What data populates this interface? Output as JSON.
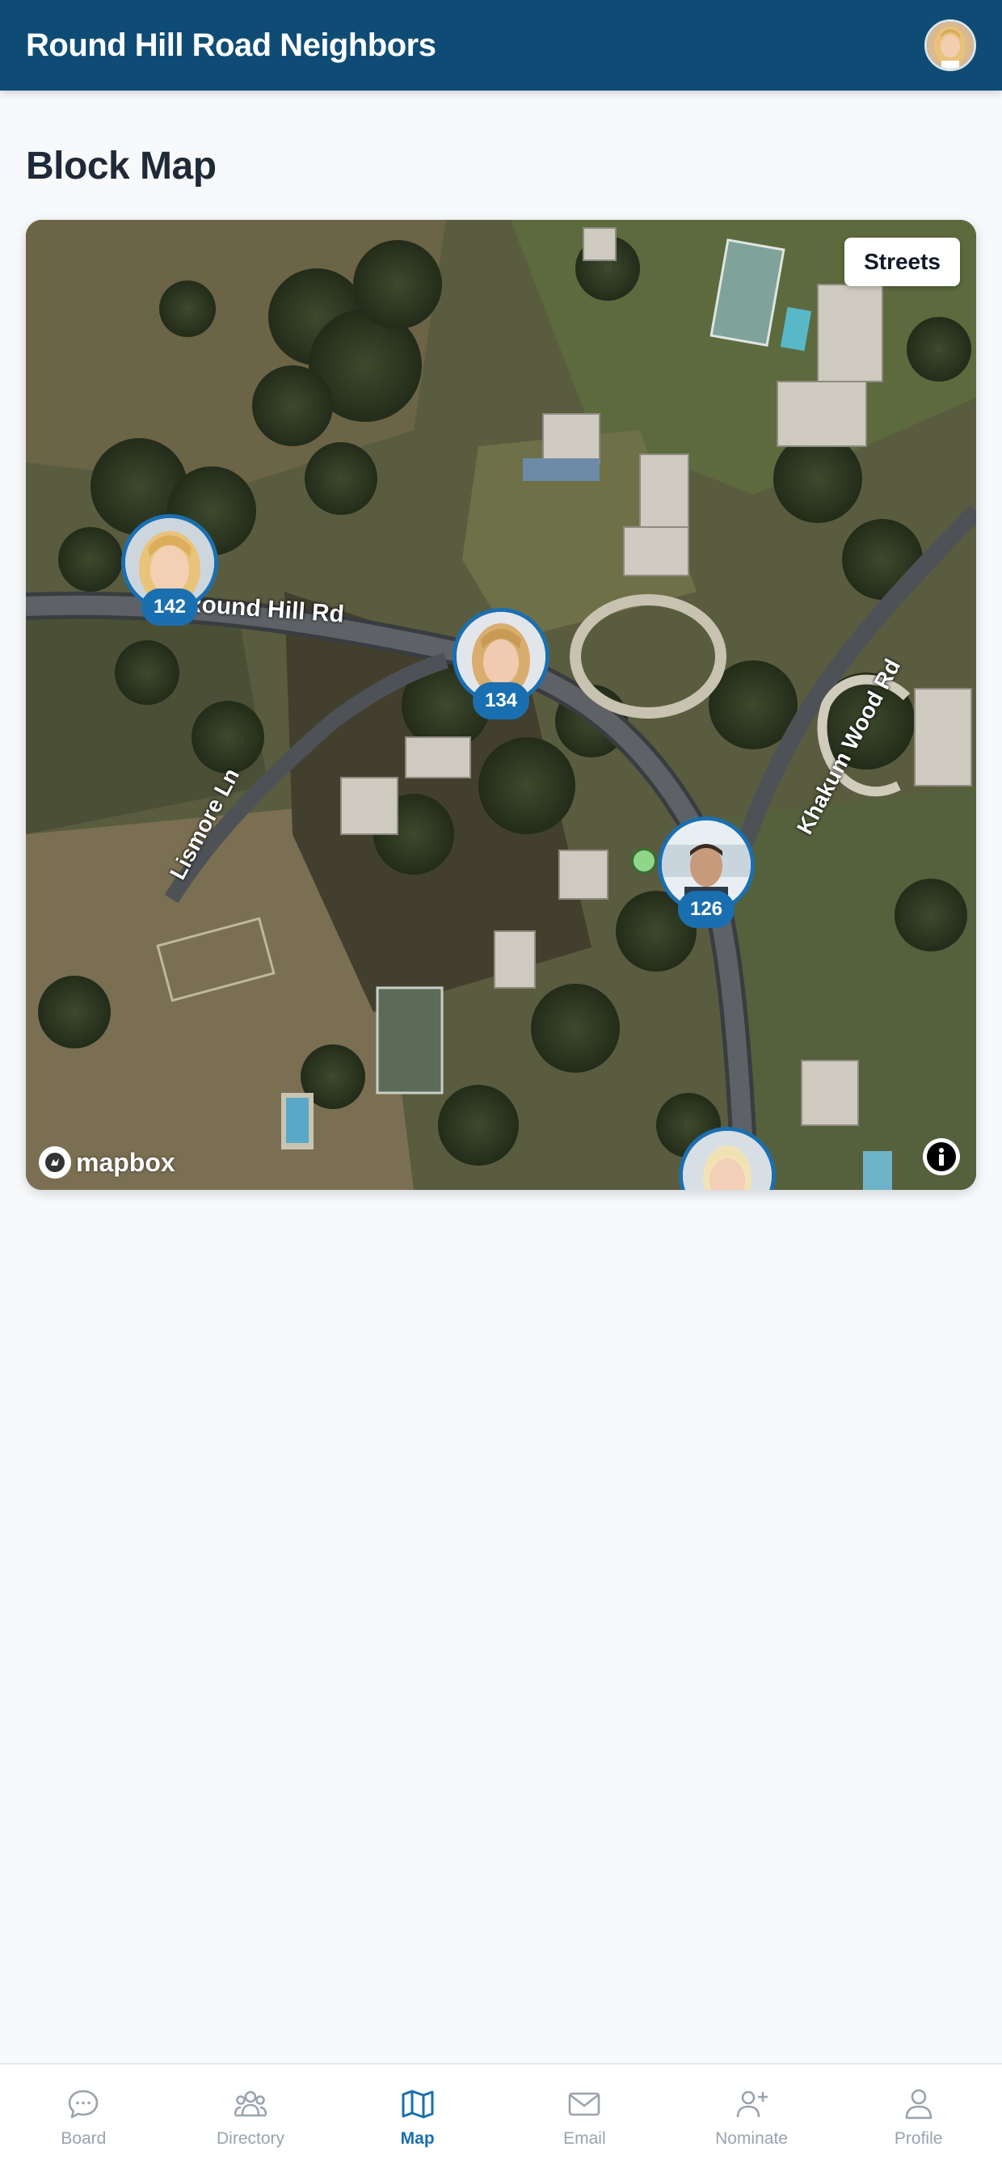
{
  "header": {
    "title": "Round Hill Road Neighbors",
    "avatar_icon": "user-avatar"
  },
  "page": {
    "title": "Block Map"
  },
  "map": {
    "style_toggle_label": "Streets",
    "roads": {
      "round_hill": "Round Hill Rd",
      "lismore": "Lismore Ln",
      "khakum": "Khakum Wood Rd"
    },
    "markers": [
      {
        "house_number": "142"
      },
      {
        "house_number": "134"
      },
      {
        "house_number": "126"
      },
      {
        "house_number": ""
      }
    ],
    "attribution": "mapbox",
    "accent_color": "#1a6fb0"
  },
  "nav": {
    "items": [
      {
        "label": "Board",
        "icon": "chat-bubble-icon"
      },
      {
        "label": "Directory",
        "icon": "people-icon"
      },
      {
        "label": "Map",
        "icon": "map-icon",
        "active": true
      },
      {
        "label": "Email",
        "icon": "mail-icon"
      },
      {
        "label": "Nominate",
        "icon": "add-user-icon"
      },
      {
        "label": "Profile",
        "icon": "user-icon"
      }
    ]
  },
  "colors": {
    "header_bg": "#0f4c75",
    "active_nav": "#1a6fb0",
    "inactive_nav": "#9aa3ae"
  }
}
